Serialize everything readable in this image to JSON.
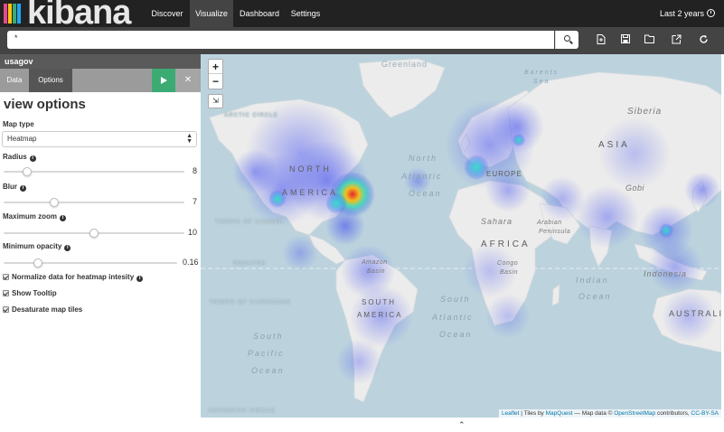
{
  "brand": {
    "name": "kibana",
    "bar_colors": [
      "#e8488b",
      "#fec514",
      "#3cab73",
      "#1ba9f5"
    ]
  },
  "nav": {
    "tabs": [
      {
        "label": "Discover",
        "active": false
      },
      {
        "label": "Visualize",
        "active": true
      },
      {
        "label": "Dashboard",
        "active": false
      },
      {
        "label": "Settings",
        "active": false
      }
    ],
    "time_range": "Last 2 years"
  },
  "search": {
    "query": "*",
    "search_icon": "search-icon",
    "tools": [
      "new-visualization-icon",
      "save-icon",
      "open-icon",
      "share-icon",
      "refresh-icon"
    ]
  },
  "sidebar": {
    "index_pattern": "usagov",
    "tabs": [
      {
        "label": "Data",
        "active": false
      },
      {
        "label": "Options",
        "active": true
      }
    ],
    "apply_icon": "play-icon",
    "discard_icon": "close-icon",
    "heading": "view options",
    "map_type": {
      "label": "Map type",
      "value": "Heatmap"
    },
    "sliders": [
      {
        "label": "Radius",
        "value": "8",
        "fraction": 0.13
      },
      {
        "label": "Blur",
        "value": "7",
        "fraction": 0.28
      },
      {
        "label": "Maximum zoom",
        "value": "10",
        "fraction": 0.5
      },
      {
        "label": "Minimum opacity",
        "value": "0.16",
        "fraction": 0.2
      }
    ],
    "checkboxes": [
      {
        "label": "Normalize data for heatmap intesity",
        "checked": true,
        "info": true
      },
      {
        "label": "Show Tooltip",
        "checked": true,
        "info": false
      },
      {
        "label": "Desaturate map tiles",
        "checked": true,
        "info": false
      }
    ]
  },
  "map": {
    "zoom_in": "+",
    "zoom_out": "−",
    "fit_icon": "fit-bounds-icon",
    "labels": {
      "greenland": "Greenland",
      "barents": "Barents",
      "barents2": "Sea",
      "siberia": "Siberia",
      "asia": "ASIA",
      "arctic": "ARCTIC CIRCLE",
      "north_america_1": "NORTH",
      "north_america_2": "AMERICA",
      "north_atlantic_1": "North",
      "north_atlantic_2": "Atlantic",
      "north_atlantic_3": "Ocean",
      "europe": "EUROPE",
      "gobi": "Gobi",
      "sahara": "Sahara",
      "arabian_1": "Arabian",
      "arabian_2": "Peninsula",
      "africa": "AFRICA",
      "tropic_cancer": "TROPIC OF CANCER",
      "equator": "EQUATOR",
      "amazon_1": "Amazon",
      "amazon_2": "Basin",
      "congo_1": "Congo",
      "congo_2": "Basin",
      "indian_1": "Indian",
      "indian_2": "Ocean",
      "indonesia": "Indonesia",
      "tropic_capricorn": "TROPIC OF CAPRICORN",
      "south_america_1": "SOUTH",
      "south_america_2": "AMERICA",
      "south_atlantic_1": "South",
      "south_atlantic_2": "Atlantic",
      "south_atlantic_3": "Ocean",
      "south_pacific_1": "South",
      "south_pacific_2": "Pacific",
      "south_pacific_3": "Ocean",
      "australia": "AUSTRALI",
      "antarctic": "ANTARCTIC CIRCLE"
    },
    "attribution": {
      "leaflet": "Leaflet",
      "sep": " | Tiles by ",
      "mapquest": "MapQuest",
      "mid": " — Map data © ",
      "osm": "OpenStreetMap",
      "contrib": " contributors, ",
      "license": "CC-BY-SA"
    },
    "colors": {
      "ocean": "#bcd3de",
      "land": "#ececec",
      "heat_low": "#4a55e8",
      "heat_mid": "#2fd0c8",
      "heat_high": "#e8242b"
    }
  },
  "collapse_icon": "chevron-up-icon"
}
